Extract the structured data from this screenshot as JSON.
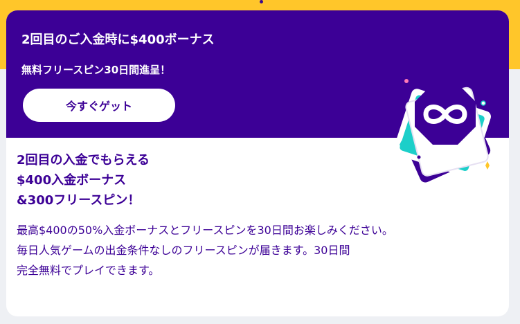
{
  "banner": {
    "title": "2回目のご入金時に$400ボーナス",
    "subtitle": "無料フリースピン30日間進呈！",
    "cta_label": "今すぐゲット"
  },
  "offer": {
    "heading_lines": [
      "2回目の入金でもらえる",
      "$400入金ボーナス",
      "&300フリースピン！"
    ],
    "description_lines": [
      "最高$400の50%入金ボーナスとフリースピンを30日間お楽しみください。",
      "毎日人気ゲームの出金条件なしのフリースピンが届きます。30日間",
      "完全無料でプレイできます。"
    ]
  },
  "colors": {
    "brand_purple": "#3c0096",
    "accent_yellow": "#ffc62a",
    "accent_teal": "#1ccfc9",
    "background": "#eef0f4"
  },
  "icons": {
    "promo_illustration": "cards-infinity-icon"
  }
}
